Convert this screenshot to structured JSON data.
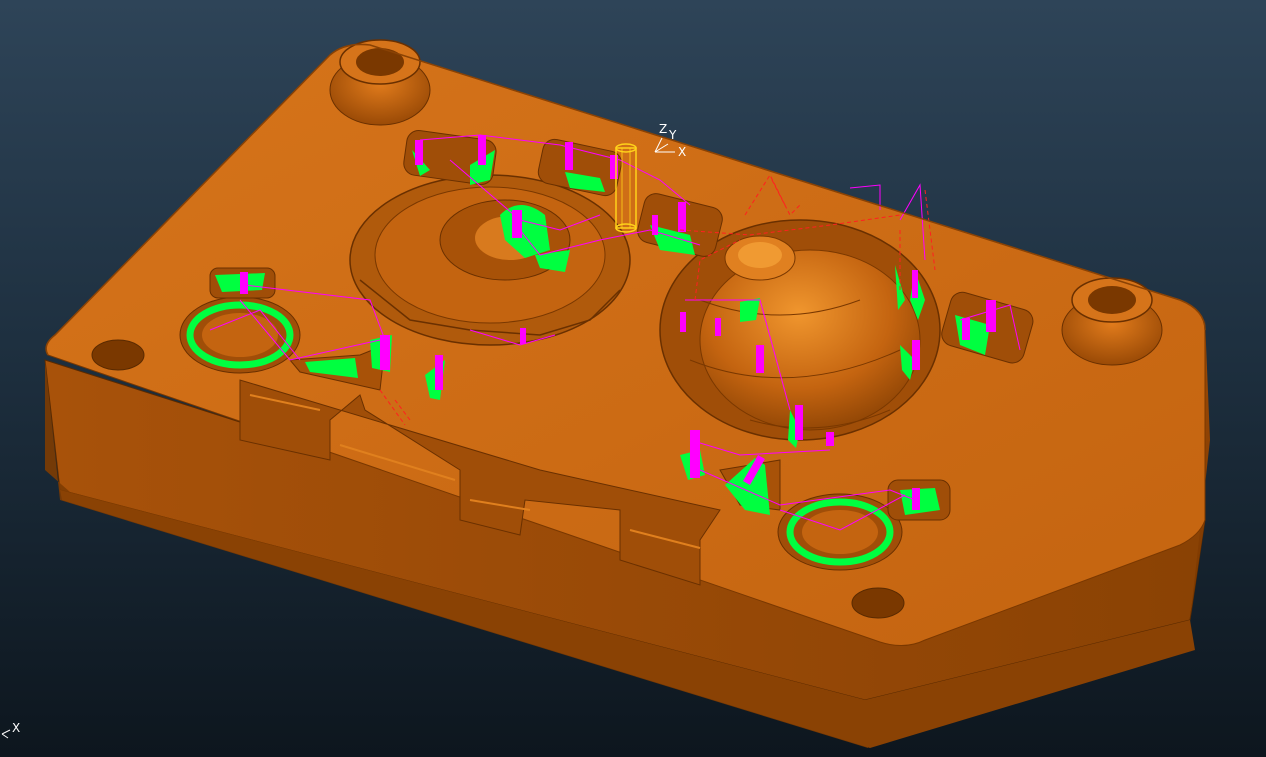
{
  "viewport": {
    "background_top": "#2e4458",
    "background_bottom": "#0d161e"
  },
  "model": {
    "part_color": "#cc6a10",
    "part_shadow_color": "#7a3a00",
    "part_highlight_color": "#e07a1a",
    "toolpath_colors": {
      "magenta": "#ff00ff",
      "green": "#00ff40",
      "red_dashed": "#ff2020"
    }
  },
  "tool": {
    "name": "tool-cylinder",
    "color": "#ffd21a"
  },
  "workplane_axis": {
    "z_label": "Z",
    "y_label": "Y",
    "x_label": "X"
  },
  "world_axis": {
    "x_label": "X"
  }
}
